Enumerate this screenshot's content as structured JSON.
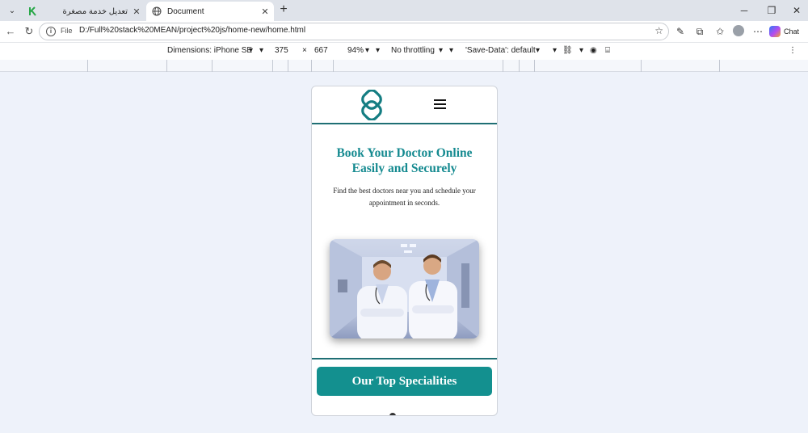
{
  "browser": {
    "tabs": [
      {
        "title": "تعديل خدمة مصغرة",
        "active": false
      },
      {
        "title": "Document",
        "active": true
      }
    ],
    "close_glyph": "✕",
    "new_tab_glyph": "+",
    "address": {
      "scheme_label": "File",
      "url": "D:/Full%20stack%20MEAN/project%20js/home-new/home.html"
    },
    "chat_label": "Chat"
  },
  "devtools": {
    "dimensions_label": "Dimensions: iPhone SE",
    "width": "375",
    "times": "×",
    "height": "667",
    "zoom": "94%",
    "throttling": "No throttling",
    "save_data": "'Save-Data': default"
  },
  "site": {
    "hero": {
      "title": "Book Your Doctor Online Easily and Securely",
      "subtitle": "Find the best doctors near you and schedule your appointment in seconds."
    },
    "specialities_button": "Our Top Specialities",
    "colors": {
      "brand": "#158a90",
      "button": "#13908f",
      "divider": "#1f6f74"
    }
  },
  "icons": {
    "tab_search": "chevron-down-icon",
    "favicon_inactive": "k-logo-icon",
    "favicon_active": "globe-icon",
    "back": "back-arrow-icon",
    "reload": "reload-icon",
    "favorite": "star-icon",
    "menu": "hamburger-icon"
  }
}
